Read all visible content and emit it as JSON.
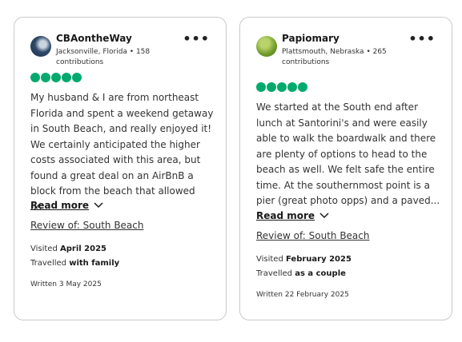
{
  "reviews": [
    {
      "username": "CBAontheWay",
      "location_contrib": "Jacksonville, Florida • 158 contributions",
      "more_label": "•••",
      "rating": 5,
      "text": "My husband & I are from northeast Florida and spent a weekend getaway in South Beach, and really enjoyed it! We certainly anticipated the higher costs associated with this area, but found a great deal on an AirBnB a block from the beach that allowed us...",
      "read_more": "Read more",
      "review_of": "Review of: South Beach",
      "visited_prefix": "Visited",
      "visited_value": "April 2025",
      "travelled_prefix": "Travelled",
      "travelled_value": "with family",
      "written": "Written 3 May 2025"
    },
    {
      "username": "Papiomary",
      "location_contrib": "Plattsmouth, Nebraska • 265 contributions",
      "more_label": "•••",
      "rating": 5,
      "text": "We started at the South end after lunch at Santorini's and were easily able to walk the boardwalk and there are plenty of options to head to the beach as well. We felt safe the entire time. At the southernmost point is a pier (great photo opps) and a paved...",
      "read_more": "Read more",
      "review_of": "Review of: South Beach",
      "visited_prefix": "Visited",
      "visited_value": "February 2025",
      "travelled_prefix": "Travelled",
      "travelled_value": "as a couple",
      "written": "Written 22 February 2025"
    }
  ],
  "colors": {
    "rating_bubble": "#00aa6c",
    "border": "#c9c9c9"
  }
}
